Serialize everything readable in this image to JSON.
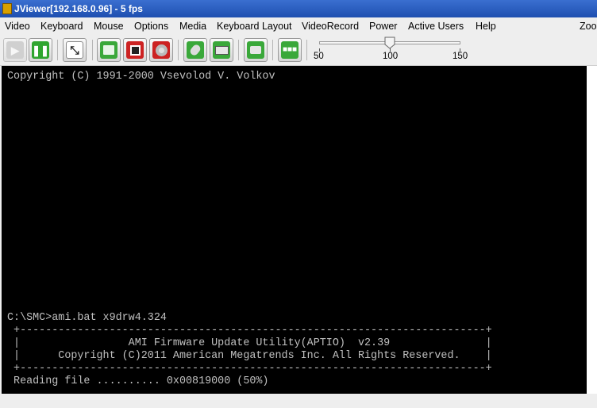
{
  "window": {
    "title": "JViewer[192.168.0.96] - 5 fps"
  },
  "menu": {
    "items": [
      "Video",
      "Keyboard",
      "Mouse",
      "Options",
      "Media",
      "Keyboard Layout",
      "VideoRecord",
      "Power",
      "Active Users",
      "Help",
      "Zoo"
    ]
  },
  "toolbar": {
    "buttons": [
      {
        "name": "play-icon",
        "state": "disabled"
      },
      {
        "name": "pause-icon"
      },
      {
        "name": "fullscreen-icon"
      },
      {
        "name": "floppy-icon"
      },
      {
        "name": "save-icon"
      },
      {
        "name": "cdrom-icon"
      },
      {
        "name": "mouse-icon"
      },
      {
        "name": "keyboard-icon"
      },
      {
        "name": "camera-icon"
      },
      {
        "name": "users-icon"
      }
    ],
    "zoom_slider": {
      "min": 50,
      "max": 150,
      "value": 100,
      "labels": [
        "50",
        "100",
        "150"
      ]
    }
  },
  "terminal": {
    "lines": [
      "Copyright (C) 1991-2000 Vsevolod V. Volkov",
      "C:\\SMC>ami.bat x9drw4.324",
      " +-------------------------------------------------------------------------+",
      " |                 AMI Firmware Update Utility(APTIO)  v2.39               |",
      " |      Copyright (C)2011 American Megatrends Inc. All Rights Reserved.    |",
      " +-------------------------------------------------------------------------+",
      " Reading file .......... 0x00819000 (50%)"
    ]
  },
  "colors": {
    "titlebar": "#1e4fb0",
    "terminal_bg": "#000000",
    "terminal_fg": "#c0c0c0"
  }
}
